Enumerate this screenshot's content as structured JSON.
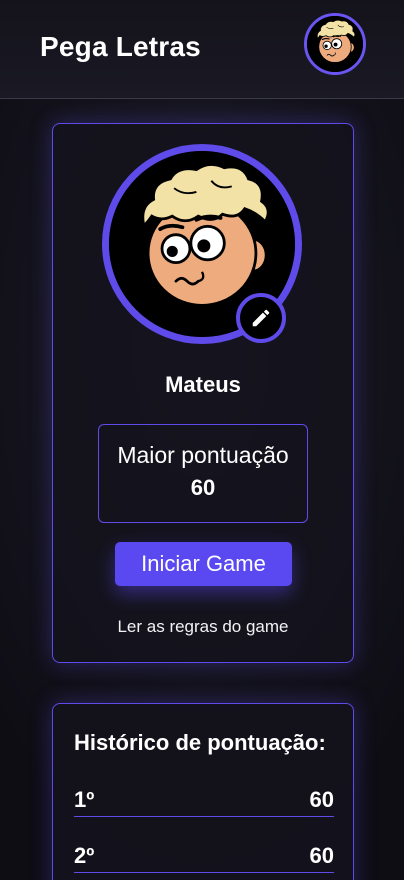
{
  "header": {
    "app_title": "Pega Letras",
    "avatar_icon": "cartoon-boy-avatar-icon"
  },
  "profile": {
    "player_name": "Mateus",
    "avatar_icon": "cartoon-boy-avatar-icon",
    "edit_icon": "pencil-icon",
    "high_score_label": "Maior pontuação",
    "high_score_value": "60",
    "start_button_label": "Iniciar Game",
    "rules_link_label": "Ler as regras do game"
  },
  "history": {
    "title": "Histórico de pontuação:",
    "rows": [
      {
        "rank": "1º",
        "score": "60"
      },
      {
        "rank": "2º",
        "score": "60"
      }
    ]
  },
  "colors": {
    "accent": "#5f4bea",
    "button": "#5a48f0",
    "background": "#15141d",
    "text": "#ffffff"
  }
}
